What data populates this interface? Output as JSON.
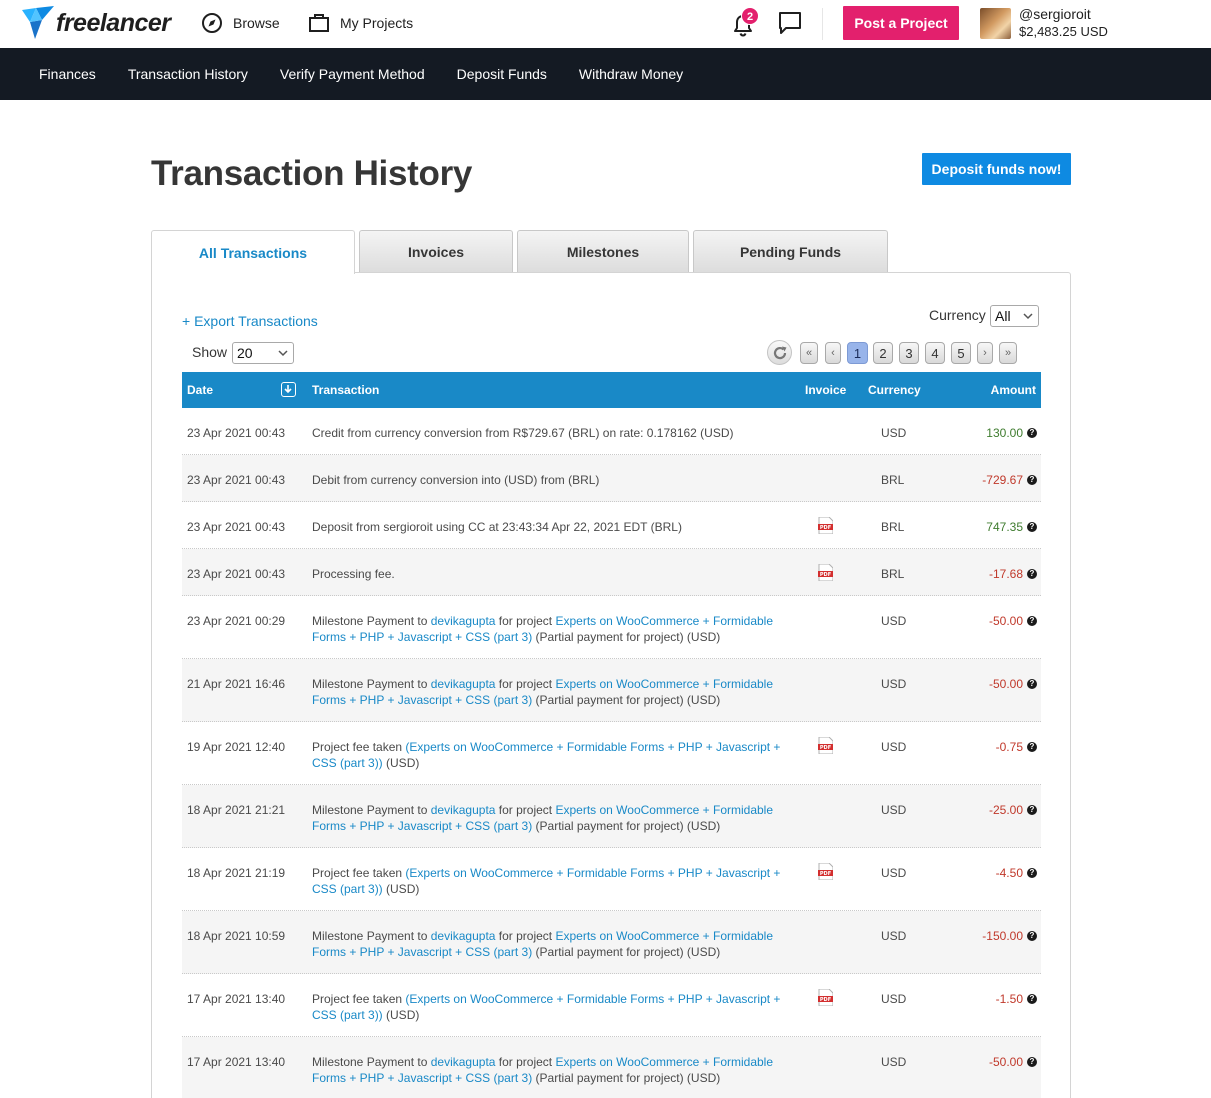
{
  "header": {
    "logo_text": "freelancer",
    "browse_label": "Browse",
    "my_projects_label": "My Projects",
    "notification_count": "2",
    "post_project_label": "Post a Project",
    "username": "@sergioroit",
    "balance": "$2,483.25 USD"
  },
  "subnav": {
    "items": [
      "Finances",
      "Transaction History",
      "Verify Payment Method",
      "Deposit Funds",
      "Withdraw Money"
    ]
  },
  "page": {
    "title": "Transaction History",
    "deposit_button": "Deposit funds now!"
  },
  "tabs": [
    {
      "label": "All Transactions",
      "active": true
    },
    {
      "label": "Invoices",
      "active": false
    },
    {
      "label": "Milestones",
      "active": false
    },
    {
      "label": "Pending Funds",
      "active": false
    }
  ],
  "controls": {
    "export_label": "+ Export Transactions",
    "currency_label": "Currency",
    "currency_value": "All",
    "show_label": "Show",
    "show_value": "20",
    "pager": [
      "«",
      "‹",
      "1",
      "2",
      "3",
      "4",
      "5",
      "›",
      "»"
    ],
    "current_page": "1"
  },
  "table": {
    "columns": [
      "Date",
      "Transaction",
      "Invoice",
      "Currency",
      "Amount"
    ],
    "rows": [
      {
        "date": "23 Apr 2021 00:43",
        "parts": [
          {
            "t": "Credit from currency conversion from R$729.67 (BRL) on rate: 0.178162 (USD)"
          }
        ],
        "pdf": false,
        "currency": "USD",
        "amount": "130.00",
        "sign": "pos"
      },
      {
        "date": "23 Apr 2021 00:43",
        "parts": [
          {
            "t": "Debit from currency conversion into (USD) from (BRL)"
          }
        ],
        "pdf": false,
        "currency": "BRL",
        "amount": "-729.67",
        "sign": "neg"
      },
      {
        "date": "23 Apr 2021 00:43",
        "parts": [
          {
            "t": "Deposit from sergioroit using CC at 23:43:34 Apr 22, 2021 EDT (BRL)"
          }
        ],
        "pdf": true,
        "currency": "BRL",
        "amount": "747.35",
        "sign": "pos"
      },
      {
        "date": "23 Apr 2021 00:43",
        "parts": [
          {
            "t": "Processing fee."
          }
        ],
        "pdf": true,
        "currency": "BRL",
        "amount": "-17.68",
        "sign": "neg"
      },
      {
        "date": "23 Apr 2021 00:29",
        "parts": [
          {
            "t": "Milestone Payment to "
          },
          {
            "t": "devikagupta",
            "link": true
          },
          {
            "t": " for project "
          },
          {
            "t": "Experts on WooCommerce + Formidable Forms + PHP + Javascript + CSS (part 3)",
            "link": true
          },
          {
            "t": " (Partial payment for project) (USD)"
          }
        ],
        "pdf": false,
        "currency": "USD",
        "amount": "-50.00",
        "sign": "neg"
      },
      {
        "date": "21 Apr 2021 16:46",
        "parts": [
          {
            "t": "Milestone Payment to "
          },
          {
            "t": "devikagupta",
            "link": true
          },
          {
            "t": " for project "
          },
          {
            "t": "Experts on WooCommerce + Formidable Forms + PHP + Javascript + CSS (part 3)",
            "link": true
          },
          {
            "t": " (Partial payment for project) (USD)"
          }
        ],
        "pdf": false,
        "currency": "USD",
        "amount": "-50.00",
        "sign": "neg"
      },
      {
        "date": "19 Apr 2021 12:40",
        "parts": [
          {
            "t": "Project fee taken "
          },
          {
            "t": "(Experts on WooCommerce + Formidable Forms + PHP + Javascript + CSS (part 3))",
            "link": true
          },
          {
            "t": " (USD)"
          }
        ],
        "pdf": true,
        "currency": "USD",
        "amount": "-0.75",
        "sign": "neg"
      },
      {
        "date": "18 Apr 2021 21:21",
        "parts": [
          {
            "t": "Milestone Payment to "
          },
          {
            "t": "devikagupta",
            "link": true
          },
          {
            "t": " for project "
          },
          {
            "t": "Experts on WooCommerce + Formidable Forms + PHP + Javascript + CSS (part 3)",
            "link": true
          },
          {
            "t": " (Partial payment for project) (USD)"
          }
        ],
        "pdf": false,
        "currency": "USD",
        "amount": "-25.00",
        "sign": "neg"
      },
      {
        "date": "18 Apr 2021 21:19",
        "parts": [
          {
            "t": "Project fee taken "
          },
          {
            "t": "(Experts on WooCommerce + Formidable Forms + PHP + Javascript + CSS (part 3))",
            "link": true
          },
          {
            "t": " (USD)"
          }
        ],
        "pdf": true,
        "currency": "USD",
        "amount": "-4.50",
        "sign": "neg"
      },
      {
        "date": "18 Apr 2021 10:59",
        "parts": [
          {
            "t": "Milestone Payment to "
          },
          {
            "t": "devikagupta",
            "link": true
          },
          {
            "t": " for project "
          },
          {
            "t": "Experts on WooCommerce + Formidable Forms + PHP + Javascript + CSS (part 3)",
            "link": true
          },
          {
            "t": " (Partial payment for project) (USD)"
          }
        ],
        "pdf": false,
        "currency": "USD",
        "amount": "-150.00",
        "sign": "neg"
      },
      {
        "date": "17 Apr 2021 13:40",
        "parts": [
          {
            "t": "Project fee taken "
          },
          {
            "t": "(Experts on WooCommerce + Formidable Forms + PHP + Javascript + CSS (part 3))",
            "link": true
          },
          {
            "t": " (USD)"
          }
        ],
        "pdf": true,
        "currency": "USD",
        "amount": "-1.50",
        "sign": "neg"
      },
      {
        "date": "17 Apr 2021 13:40",
        "parts": [
          {
            "t": "Milestone Payment to "
          },
          {
            "t": "devikagupta",
            "link": true
          },
          {
            "t": " for project "
          },
          {
            "t": "Experts on WooCommerce + Formidable Forms + PHP + Javascript + CSS (part 3)",
            "link": true
          },
          {
            "t": " (Partial payment for project) (USD)"
          }
        ],
        "pdf": false,
        "currency": "USD",
        "amount": "-50.00",
        "sign": "neg"
      }
    ]
  },
  "colors": {
    "brand_blue": "#1989c7",
    "post_pink": "#e3206d",
    "nav_dark": "#141a23",
    "amount_positive": "#3f7c2f",
    "amount_negative": "#c0392b"
  }
}
